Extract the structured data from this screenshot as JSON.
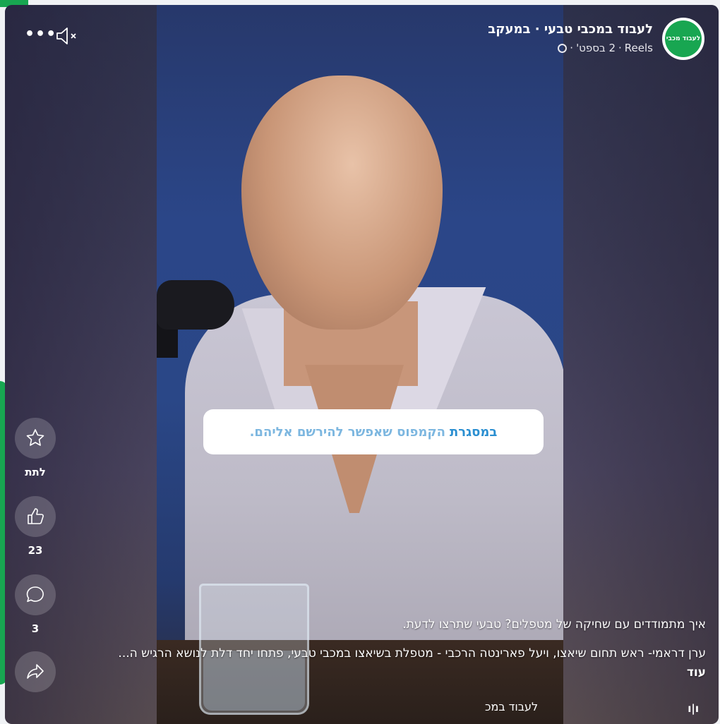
{
  "post": {
    "page_name": "לעבוד במכבי טבעי · במעקב",
    "meta_date": "2 בספט'",
    "meta_type": "Reels",
    "avatar_text": "לעבוד מכבי"
  },
  "video": {
    "caption_highlight": "במסגרת",
    "caption_rest": "הקמפוס שאפשר להירשם אליהם."
  },
  "actions": {
    "give_label": "לתת",
    "like_count": "23",
    "comment_count": "3"
  },
  "description": {
    "line1": "איך מתמודדים עם שחיקה של מטפלים? טבעי שתרצו לדעת.",
    "line2": "ערן דראמי- ראש תחום שיאצו, ויעל פארינטה הרכבי - מטפלת בשיאצו במכבי טבעי, פתחו יחד דלת לנושא הרגיש ה...",
    "more": "עוד",
    "audio_name": "לעבוד במכ"
  },
  "colors": {
    "brand_green": "#18a651",
    "caption_highlight": "#2b8fd1"
  },
  "icons": [
    "more-dots-icon",
    "mute-icon",
    "globe-icon",
    "star-sparkle-icon",
    "like-icon",
    "comment-icon",
    "share-icon",
    "audio-icon"
  ]
}
